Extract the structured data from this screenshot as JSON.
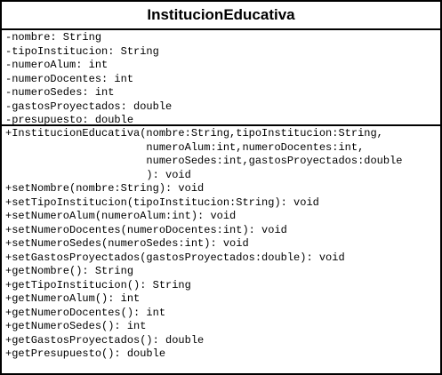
{
  "class_name": "InstitucionEducativa",
  "attributes": [
    "-nombre: String",
    "-tipoInstitucion: String",
    "-numeroAlum: int",
    "-numeroDocentes: int",
    "-numeroSedes: int",
    "-gastosProyectados: double",
    "-presupuesto: double"
  ],
  "methods": [
    "+InstitucionEducativa(nombre:String,tipoInstitucion:String,",
    "                      numeroAlum:int,numeroDocentes:int,",
    "                      numeroSedes:int,gastosProyectados:double",
    "                      ): void",
    "+setNombre(nombre:String): void",
    "+setTipoInstitucion(tipoInstitucion:String): void",
    "+setNumeroAlum(numeroAlum:int): void",
    "+setNumeroDocentes(numeroDocentes:int): void",
    "+setNumeroSedes(numeroSedes:int): void",
    "+setGastosProyectados(gastosProyectados:double): void",
    "+getNombre(): String",
    "+getTipoInstitucion(): String",
    "+getNumeroAlum(): int",
    "+getNumeroDocentes(): int",
    "+getNumeroSedes(): int",
    "+getGastosProyectados(): double",
    "+getPresupuesto(): double"
  ]
}
